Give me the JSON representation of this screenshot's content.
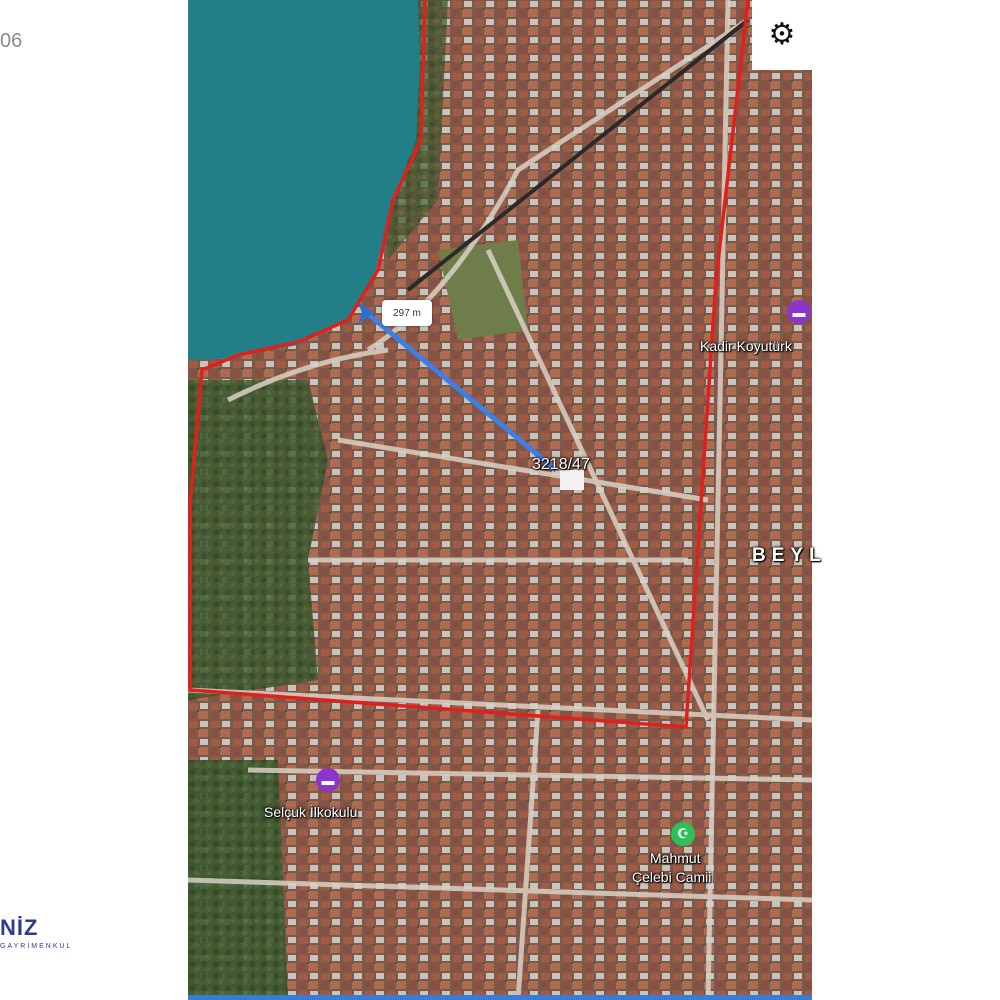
{
  "frame_number": "06",
  "brand": {
    "name": "NİZ",
    "subtitle": "GAYRİMENKUL"
  },
  "map": {
    "distance_label": "297 m",
    "parcel_label": "3218/47",
    "place_labels": {
      "kadir": "Kadir Koyutürk",
      "beyl": "BEYL",
      "selcuk": "Selçuk İlkokulu",
      "mahmut_line1": "Mahmut",
      "mahmut_line2": "Çelebi Camii"
    },
    "colors": {
      "water": "#237f87",
      "boundary": "#e0201c",
      "measure_line": "#3d7fe6",
      "school_poi": "#8e35c9",
      "mosque_poi": "#2ec05a"
    }
  },
  "icons": {
    "settings": "gear-icon",
    "marker": "location-marker-icon",
    "school": "school-icon",
    "mosque": "mosque-icon"
  }
}
